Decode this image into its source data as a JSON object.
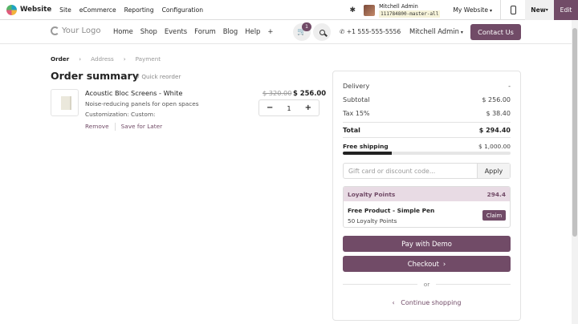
{
  "adminbar": {
    "app_title": "Website",
    "menu": [
      "Site",
      "eCommerce",
      "Reporting",
      "Configuration"
    ],
    "user_name": "Mitchell Admin",
    "db_name": "111784800-master-all",
    "website_selector": "My Website",
    "new_label": "New",
    "edit_label": "Edit"
  },
  "header": {
    "logo_text": "Your Logo",
    "nav": [
      "Home",
      "Shop",
      "Events",
      "Forum",
      "Blog",
      "Help",
      "+"
    ],
    "cart_count": "1",
    "phone": "+1 555-555-5556",
    "user": "Mitchell Admin",
    "contact_label": "Contact Us"
  },
  "breadcrumb": {
    "steps": [
      "Order",
      "Address",
      "Payment"
    ]
  },
  "summary": {
    "title": "Order summary",
    "reorder_label": "Quick reorder"
  },
  "product": {
    "name": "Acoustic Bloc Screens - White",
    "description": "Noise-reducing panels for open spaces",
    "customization": "Customization: Custom:",
    "remove_label": "Remove",
    "save_later_label": "Save for Later",
    "old_price": "$ 320.00",
    "price": "$ 256.00",
    "qty": "1",
    "minus": "−",
    "plus": "+"
  },
  "totals": {
    "delivery_label": "Delivery",
    "delivery_value": "-",
    "subtotal_label": "Subtotal",
    "subtotal_value": "$ 256.00",
    "tax_label": "Tax 15%",
    "tax_value": "$ 38.40",
    "total_label": "Total",
    "total_value": "$ 294.40",
    "free_shipping_label": "Free shipping",
    "free_shipping_threshold": "$ 1,000.00",
    "free_shipping_progress": 0.294
  },
  "gift": {
    "placeholder": "Gift card or discount code...",
    "apply_label": "Apply"
  },
  "loyalty": {
    "title": "Loyalty Points",
    "points": "294.4",
    "reward_name": "Free Product - Simple Pen",
    "reward_cost": "50 Loyalty Points",
    "claim_label": "Claim"
  },
  "actions": {
    "pay_demo_label": "Pay with Demo",
    "checkout_label": "Checkout",
    "or_label": "or",
    "continue_label": "Continue shopping"
  },
  "colors": {
    "primary": "#714b67"
  }
}
